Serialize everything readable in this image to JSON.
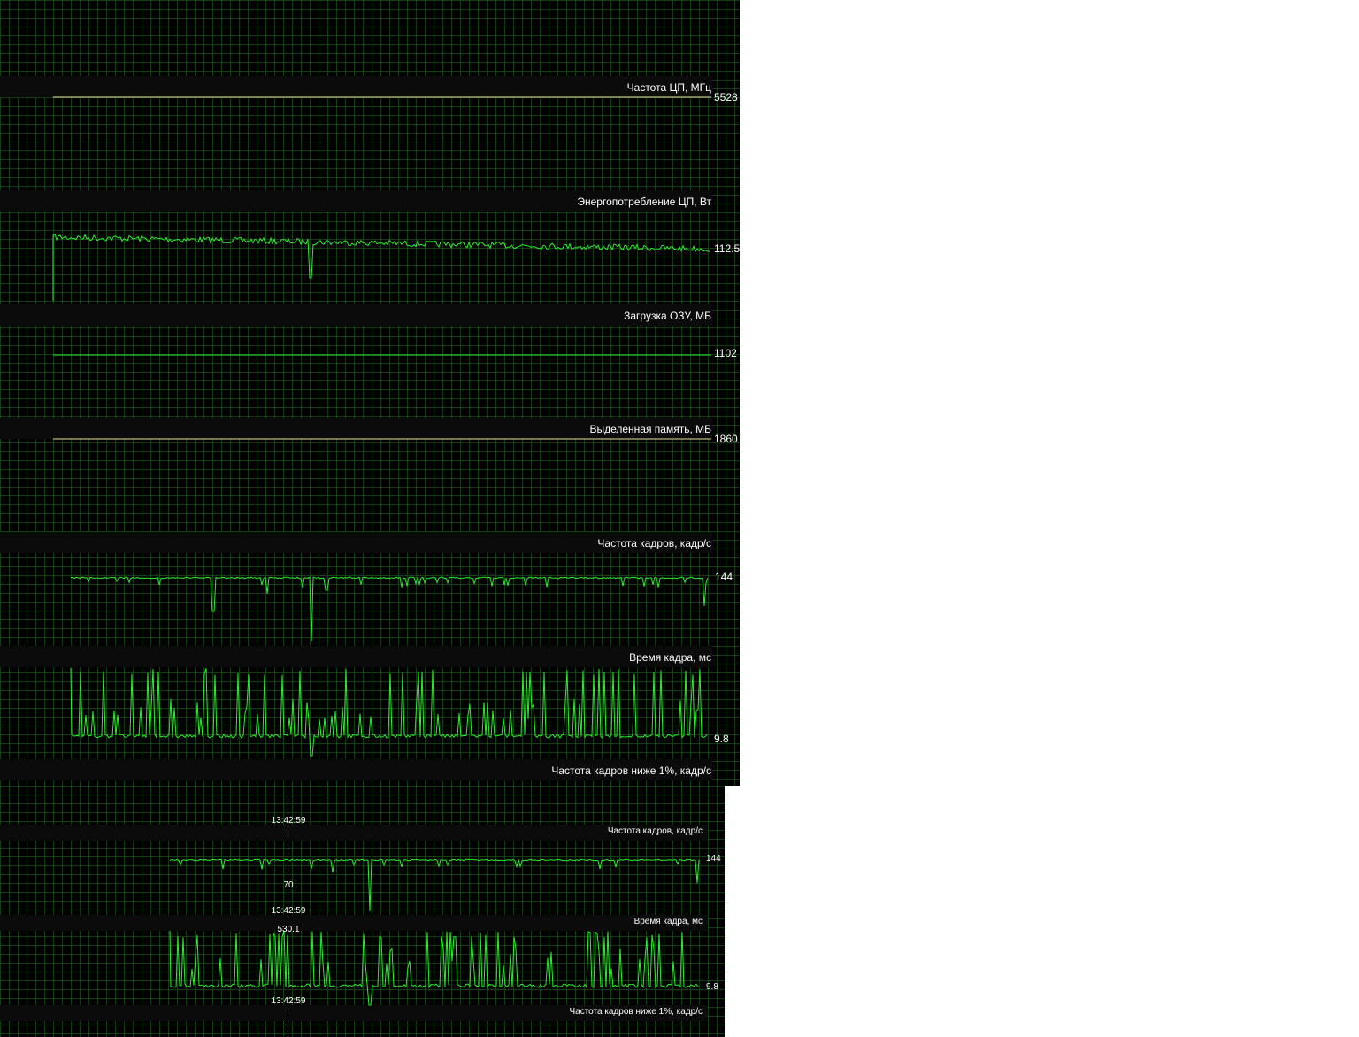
{
  "top_panel": {
    "graphs": [
      {
        "label": "Частота ЦП, МГц",
        "value": "5528",
        "kind": "flat",
        "color": "#e8e0a0"
      },
      {
        "label": "Энергопотребление ЦП, Вт",
        "value": "112.5",
        "kind": "power",
        "color": "#2cf02c"
      },
      {
        "label": "Загрузка ОЗУ, МБ",
        "value": "1102",
        "kind": "flat",
        "color": "#2cf02c"
      },
      {
        "label": "Выделенная память, МБ",
        "value": "1860",
        "kind": "flat",
        "color": "#e8e0a0"
      },
      {
        "label": "Частота кадров, кадр/с",
        "value": "144",
        "kind": "fps",
        "color": "#2cf02c"
      },
      {
        "label": "Время кадра, мс",
        "value": "9.8",
        "kind": "frametime",
        "color": "#2cf02c"
      },
      {
        "label": "Частота кадров ниже 1%, кадр/с",
        "value": "",
        "kind": "none",
        "color": "#2cf02c"
      }
    ]
  },
  "bottom_panel": {
    "cursor_time_1": "13:42:59",
    "cursor_time_2": "13:42:59",
    "cursor_time_3": "13:42:59",
    "cursor_value_fps": "70",
    "cursor_value_frametime": "530.1",
    "graphs": [
      {
        "label": "Частота кадров, кадр/с",
        "value": "144",
        "kind": "fps",
        "color": "#2cf02c"
      },
      {
        "label": "Время кадра, мс",
        "value": "9.8",
        "kind": "frametime",
        "color": "#2cf02c"
      },
      {
        "label": "Частота кадров ниже 1%, кадр/с",
        "value": "",
        "kind": "none",
        "color": "#2cf02c"
      }
    ]
  },
  "colors": {
    "background": "#000000",
    "grid": "#185018",
    "trace_green": "#2cf02c",
    "trace_yellow": "#e8e0a0"
  }
}
